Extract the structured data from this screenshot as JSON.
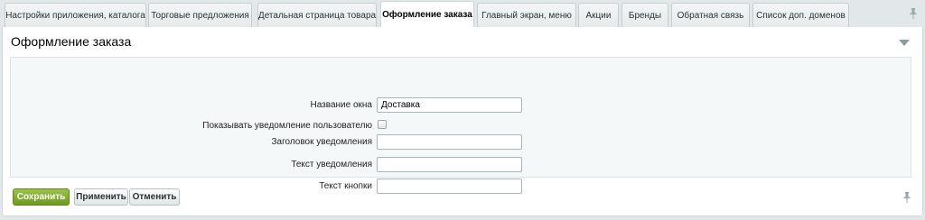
{
  "tabs": [
    {
      "label": "Настройки приложения, каталога",
      "active": false
    },
    {
      "label": "Торговые предложения",
      "active": false
    },
    {
      "label": "Детальная страница товара",
      "active": false
    },
    {
      "label": "Оформление заказа",
      "active": true
    },
    {
      "label": "Главный экран, меню",
      "active": false
    },
    {
      "label": "Акции",
      "active": false
    },
    {
      "label": "Бренды",
      "active": false
    },
    {
      "label": "Обратная связь",
      "active": false
    },
    {
      "label": "Список доп. доменов",
      "active": false
    }
  ],
  "panel": {
    "title": "Оформление заказа"
  },
  "form": {
    "window_name": {
      "label": "Название окна",
      "value": "Доставка"
    },
    "show_notification": {
      "label": "Показывать уведомление пользователю",
      "checked": false
    },
    "notification_title": {
      "label": "Заголовок уведомления",
      "value": ""
    },
    "notification_text": {
      "label": "Текст уведомления",
      "value": ""
    },
    "button_text": {
      "label": "Текст кнопки",
      "value": ""
    }
  },
  "buttons": {
    "save": "Сохранить",
    "apply": "Применить",
    "cancel": "Отменить"
  },
  "colors": {
    "save_button": "#7ea82c",
    "background": "#e2e8ea",
    "form_area": "#f4f8f8"
  },
  "icons": {
    "pin": "pin-icon",
    "collapse": "chevron-down-icon"
  }
}
